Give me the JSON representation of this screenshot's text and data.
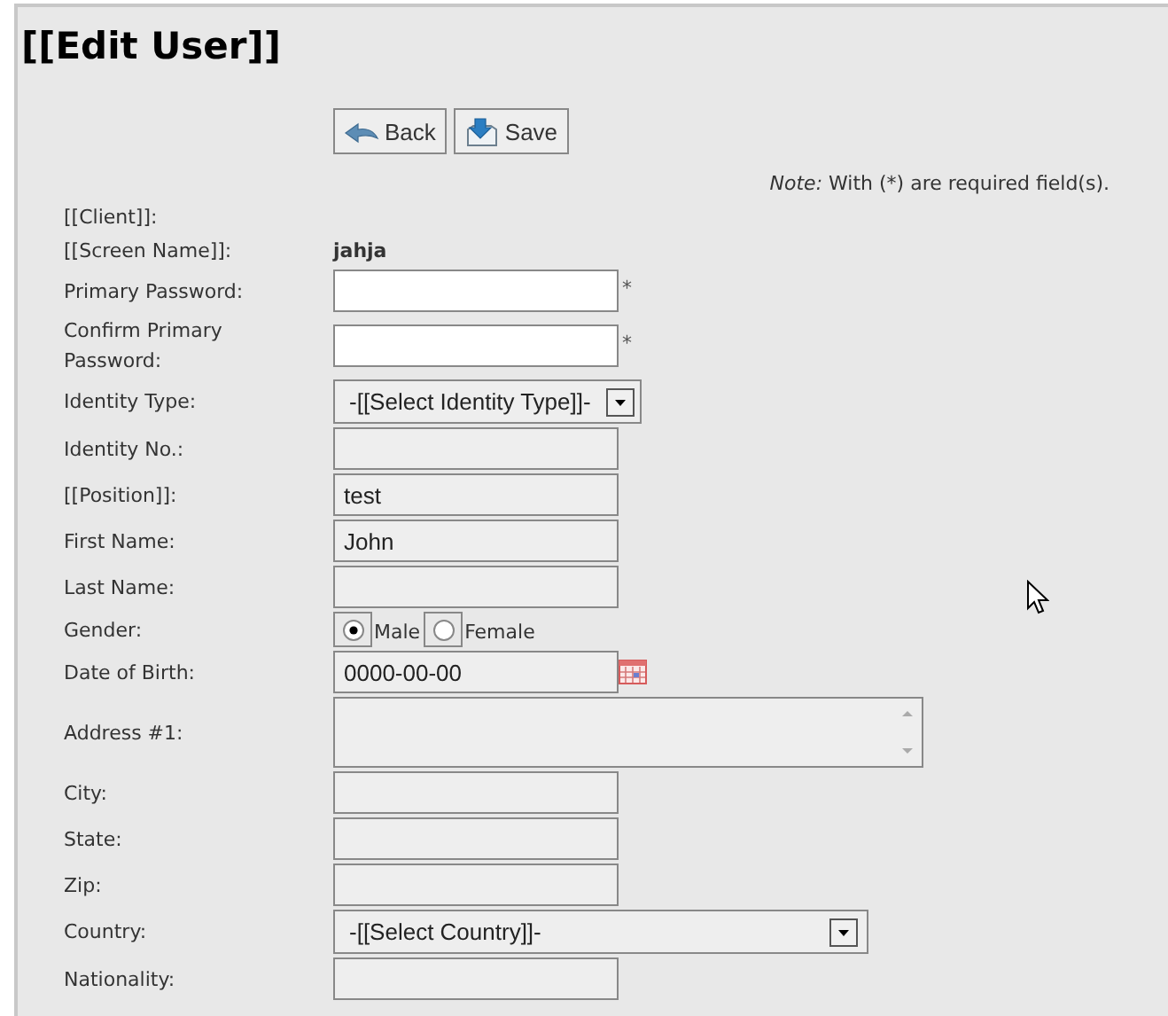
{
  "title": "[[Edit User]]",
  "buttons": [
    {
      "label": "Back",
      "kind": "back"
    },
    {
      "label": "Save",
      "kind": "save"
    }
  ],
  "note": {
    "label": "Note:",
    "text": "With (*) are required field(s)."
  },
  "fields": [
    {
      "label": "[[Client]]:",
      "kind": "static"
    },
    {
      "label": "[[Screen Name]]:",
      "kind": "static",
      "value": "jahja"
    },
    {
      "label": "Primary Password:",
      "kind": "password",
      "required_mark": "*"
    },
    {
      "label": "Confirm Primary Password:",
      "kind": "password",
      "required_mark": "*"
    },
    {
      "label": "Identity Type:",
      "kind": "select",
      "value": "-[[Select Identity Type]]-"
    },
    {
      "label": "Identity No.:",
      "kind": "text"
    },
    {
      "label": "[[Position]]:",
      "kind": "text",
      "value": "test"
    },
    {
      "label": "First Name:",
      "kind": "text",
      "value": "John"
    },
    {
      "label": "Last Name:",
      "kind": "text"
    },
    {
      "label": "Gender:",
      "kind": "radio",
      "options": [
        {
          "label": "Male",
          "selected": true
        },
        {
          "label": "Female",
          "selected": false
        }
      ]
    },
    {
      "label": "Date of Birth:",
      "kind": "date",
      "value": "0000-00-00"
    },
    {
      "label": "Address #1:",
      "kind": "textarea"
    },
    {
      "label": "City:",
      "kind": "text"
    },
    {
      "label": "State:",
      "kind": "text"
    },
    {
      "label": "Zip:",
      "kind": "text"
    },
    {
      "label": "Country:",
      "kind": "wideselect",
      "value": "-[[Select Country]]-"
    },
    {
      "label": "Nationality:",
      "kind": "text"
    }
  ]
}
